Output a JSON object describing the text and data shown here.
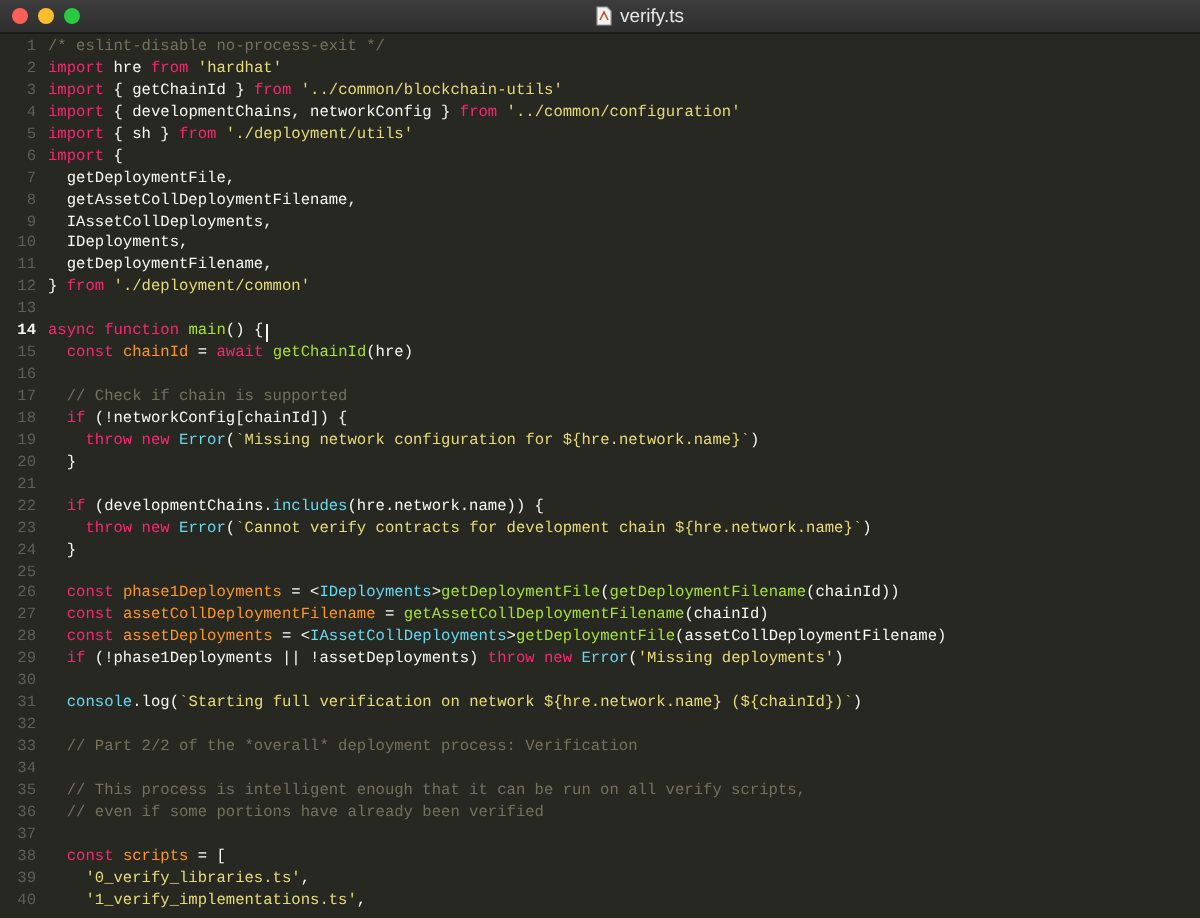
{
  "window": {
    "title": "verify.ts"
  },
  "editor": {
    "lines": [
      {
        "number": "1",
        "current": false,
        "tokens": [
          {
            "kind": "comment",
            "text": "/* eslint-disable no-process-exit */"
          }
        ]
      },
      {
        "number": "2",
        "current": false,
        "tokens": [
          {
            "kind": "keyword",
            "text": "import"
          },
          {
            "kind": "plain",
            "text": " hre "
          },
          {
            "kind": "keyword",
            "text": "from "
          },
          {
            "kind": "string",
            "text": "'hardhat'"
          }
        ]
      },
      {
        "number": "3",
        "current": false,
        "tokens": [
          {
            "kind": "keyword",
            "text": "import"
          },
          {
            "kind": "plain",
            "text": " { getChainId } "
          },
          {
            "kind": "keyword",
            "text": "from "
          },
          {
            "kind": "string",
            "text": "'../common/blockchain-utils'"
          }
        ]
      },
      {
        "number": "4",
        "current": false,
        "tokens": [
          {
            "kind": "keyword",
            "text": "import"
          },
          {
            "kind": "plain",
            "text": " { developmentChains, networkConfig } "
          },
          {
            "kind": "keyword",
            "text": "from "
          },
          {
            "kind": "string",
            "text": "'../common/configuration'"
          }
        ]
      },
      {
        "number": "5",
        "current": false,
        "tokens": [
          {
            "kind": "keyword",
            "text": "import"
          },
          {
            "kind": "plain",
            "text": " { sh } "
          },
          {
            "kind": "keyword",
            "text": "from "
          },
          {
            "kind": "string",
            "text": "'./deployment/utils'"
          }
        ]
      },
      {
        "number": "6",
        "current": false,
        "tokens": [
          {
            "kind": "keyword",
            "text": "import"
          },
          {
            "kind": "plain",
            "text": " {"
          }
        ]
      },
      {
        "number": "7",
        "current": false,
        "tokens": [
          {
            "kind": "plain",
            "text": "  getDeploymentFile,"
          }
        ]
      },
      {
        "number": "8",
        "current": false,
        "tokens": [
          {
            "kind": "plain",
            "text": "  getAssetCollDeploymentFilename,"
          }
        ]
      },
      {
        "number": "9",
        "current": false,
        "tokens": [
          {
            "kind": "plain",
            "text": "  IAssetCollDeployments,"
          }
        ]
      },
      {
        "number": "10",
        "current": false,
        "tokens": [
          {
            "kind": "plain",
            "text": "  IDeployments,"
          }
        ]
      },
      {
        "number": "11",
        "current": false,
        "tokens": [
          {
            "kind": "plain",
            "text": "  getDeploymentFilename,"
          }
        ]
      },
      {
        "number": "12",
        "current": false,
        "tokens": [
          {
            "kind": "plain",
            "text": "} "
          },
          {
            "kind": "keyword",
            "text": "from "
          },
          {
            "kind": "string",
            "text": "'./deployment/common'"
          }
        ]
      },
      {
        "number": "13",
        "current": false
      },
      {
        "number": "14",
        "current": true,
        "tokens": [
          {
            "kind": "keyword",
            "text": "async function "
          },
          {
            "kind": "function",
            "text": "main"
          },
          {
            "kind": "plain",
            "text": "() {"
          }
        ]
      },
      {
        "number": "15",
        "current": false,
        "tokens": [
          {
            "kind": "keyword",
            "text": "  const "
          },
          {
            "kind": "variable",
            "text": "chainId"
          },
          {
            "kind": "plain",
            "text": " = "
          },
          {
            "kind": "keyword",
            "text": "await "
          },
          {
            "kind": "function",
            "text": "getChainId"
          },
          {
            "kind": "plain",
            "text": "(hre)"
          }
        ]
      },
      {
        "number": "16",
        "current": false
      },
      {
        "number": "17",
        "current": false,
        "tokens": [
          {
            "kind": "comment",
            "text": "  // Check if chain is supported"
          }
        ]
      },
      {
        "number": "18",
        "current": false,
        "tokens": [
          {
            "kind": "keyword",
            "text": "  if"
          },
          {
            "kind": "plain",
            "text": " (!networkConfig[chainId]) {"
          }
        ]
      },
      {
        "number": "19",
        "current": false,
        "tokens": [
          {
            "kind": "keyword",
            "text": "    throw new "
          },
          {
            "kind": "type",
            "text": "Error"
          },
          {
            "kind": "plain",
            "text": "("
          },
          {
            "kind": "string",
            "text": "`Missing network configuration for ${hre.network.name}`"
          },
          {
            "kind": "plain",
            "text": ")"
          }
        ]
      },
      {
        "number": "20",
        "current": false,
        "tokens": [
          {
            "kind": "plain",
            "text": "  }"
          }
        ]
      },
      {
        "number": "21",
        "current": false
      },
      {
        "number": "22",
        "current": false,
        "tokens": [
          {
            "kind": "keyword",
            "text": "  if"
          },
          {
            "kind": "plain",
            "text": " (developmentChains."
          },
          {
            "kind": "type",
            "text": "includes"
          },
          {
            "kind": "plain",
            "text": "(hre.network.name)) {"
          }
        ]
      },
      {
        "number": "23",
        "current": false,
        "tokens": [
          {
            "kind": "keyword",
            "text": "    throw new "
          },
          {
            "kind": "type",
            "text": "Error"
          },
          {
            "kind": "plain",
            "text": "("
          },
          {
            "kind": "string",
            "text": "`Cannot verify contracts for development chain ${hre.network.name}`"
          },
          {
            "kind": "plain",
            "text": ")"
          }
        ]
      },
      {
        "number": "24",
        "current": false,
        "tokens": [
          {
            "kind": "plain",
            "text": "  }"
          }
        ]
      },
      {
        "number": "25",
        "current": false
      },
      {
        "number": "26",
        "current": false,
        "tokens": [
          {
            "kind": "keyword",
            "text": "  const "
          },
          {
            "kind": "variable",
            "text": "phase1Deployments"
          },
          {
            "kind": "plain",
            "text": " = <"
          },
          {
            "kind": "type",
            "text": "IDeployments"
          },
          {
            "kind": "plain",
            "text": ">"
          },
          {
            "kind": "function",
            "text": "getDeploymentFile"
          },
          {
            "kind": "plain",
            "text": "("
          },
          {
            "kind": "function",
            "text": "getDeploymentFilename"
          },
          {
            "kind": "plain",
            "text": "(chainId))"
          }
        ]
      },
      {
        "number": "27",
        "current": false,
        "tokens": [
          {
            "kind": "keyword",
            "text": "  const "
          },
          {
            "kind": "variable",
            "text": "assetCollDeploymentFilename"
          },
          {
            "kind": "plain",
            "text": " = "
          },
          {
            "kind": "function",
            "text": "getAssetCollDeploymentFilename"
          },
          {
            "kind": "plain",
            "text": "(chainId)"
          }
        ]
      },
      {
        "number": "28",
        "current": false,
        "tokens": [
          {
            "kind": "keyword",
            "text": "  const "
          },
          {
            "kind": "variable",
            "text": "assetDeployments"
          },
          {
            "kind": "plain",
            "text": " = <"
          },
          {
            "kind": "type",
            "text": "IAssetCollDeployments"
          },
          {
            "kind": "plain",
            "text": ">"
          },
          {
            "kind": "function",
            "text": "getDeploymentFile"
          },
          {
            "kind": "plain",
            "text": "(assetCollDeploymentFilename)"
          }
        ]
      },
      {
        "number": "29",
        "current": false,
        "tokens": [
          {
            "kind": "keyword",
            "text": "  if"
          },
          {
            "kind": "plain",
            "text": " (!phase1Deployments || !assetDeployments) "
          },
          {
            "kind": "keyword",
            "text": "throw new "
          },
          {
            "kind": "type",
            "text": "Error"
          },
          {
            "kind": "plain",
            "text": "("
          },
          {
            "kind": "string",
            "text": "'Missing deployments'"
          },
          {
            "kind": "plain",
            "text": ")"
          }
        ]
      },
      {
        "number": "30",
        "current": false
      },
      {
        "number": "31",
        "current": false,
        "tokens": [
          {
            "kind": "type",
            "text": "  console"
          },
          {
            "kind": "plain",
            "text": ".log("
          },
          {
            "kind": "string",
            "text": "`Starting full verification on network ${hre.network.name} (${chainId})`"
          },
          {
            "kind": "plain",
            "text": ")"
          }
        ]
      },
      {
        "number": "32",
        "current": false
      },
      {
        "number": "33",
        "current": false,
        "tokens": [
          {
            "kind": "comment",
            "text": "  // Part 2/2 of the *overall* deployment process: Verification"
          }
        ]
      },
      {
        "number": "34",
        "current": false
      },
      {
        "number": "35",
        "current": false,
        "tokens": [
          {
            "kind": "comment",
            "text": "  // This process is intelligent enough that it can be run on all verify scripts,"
          }
        ]
      },
      {
        "number": "36",
        "current": false,
        "tokens": [
          {
            "kind": "comment",
            "text": "  // even if some portions have already been verified"
          }
        ]
      },
      {
        "number": "37",
        "current": false
      },
      {
        "number": "38",
        "current": false,
        "tokens": [
          {
            "kind": "keyword",
            "text": "  const "
          },
          {
            "kind": "variable",
            "text": "scripts"
          },
          {
            "kind": "plain",
            "text": " = ["
          }
        ]
      },
      {
        "number": "39",
        "current": false,
        "tokens": [
          {
            "kind": "string",
            "text": "    '0_verify_libraries.ts'"
          },
          {
            "kind": "plain",
            "text": ","
          }
        ]
      },
      {
        "number": "40",
        "current": false,
        "tokens": [
          {
            "kind": "string",
            "text": "    '1_verify_implementations.ts'"
          },
          {
            "kind": "plain",
            "text": ","
          }
        ]
      }
    ]
  }
}
